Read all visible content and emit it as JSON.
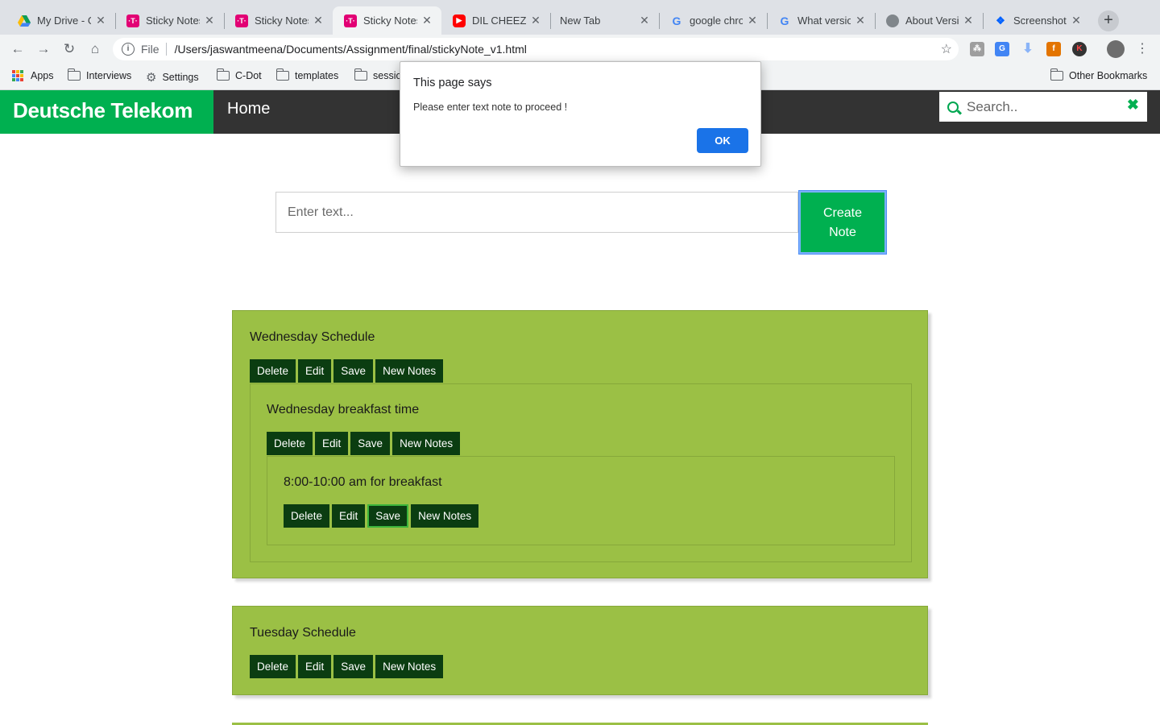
{
  "browser": {
    "tabs": [
      {
        "label": "My Drive - G",
        "icon": "google-drive-icon",
        "color": "#f4b400"
      },
      {
        "label": "Sticky Notes",
        "icon": "telekom-icon",
        "color": "#e20074"
      },
      {
        "label": "Sticky Notes",
        "icon": "telekom-icon",
        "color": "#e20074"
      },
      {
        "label": "Sticky Notes",
        "icon": "telekom-icon",
        "color": "#e20074",
        "active": true
      },
      {
        "label": "DIL CHEEZ T",
        "icon": "youtube-icon",
        "color": "#ff0000"
      },
      {
        "label": "New Tab",
        "icon": "",
        "color": ""
      },
      {
        "label": "google chro",
        "icon": "google-icon",
        "color": "#4285f4"
      },
      {
        "label": "What versio",
        "icon": "google-icon",
        "color": "#4285f4"
      },
      {
        "label": "About Versi",
        "icon": "globe-icon",
        "color": "#5f6368"
      },
      {
        "label": "Screenshot",
        "icon": "dropbox-icon",
        "color": "#0061ff"
      }
    ],
    "url_scheme": "File",
    "url": "/Users/jaswantmeena/Documents/Assignment/final/stickyNote_v1.html",
    "bookmarks": [
      "Apps",
      "Interviews",
      "Settings",
      "C-Dot",
      "templates",
      "sessio"
    ],
    "other_bookmarks": "Other Bookmarks"
  },
  "app": {
    "brand": "Deutsche Telekom",
    "nav_home": "Home",
    "search_placeholder": "Search..",
    "search_clear": "✖",
    "input_placeholder": "Enter text...",
    "create_label": "Create Note",
    "accent": "#00b050",
    "note_color": "#9bc045",
    "button_color": "#0b3d11"
  },
  "buttons": {
    "delete": "Delete",
    "edit": "Edit",
    "save": "Save",
    "new_notes": "New Notes"
  },
  "notes": [
    {
      "text": "Wednesday Schedule",
      "children": [
        {
          "text": "Wednesday breakfast time",
          "children": [
            {
              "text": "8:00-10:00 am for breakfast"
            }
          ]
        }
      ]
    },
    {
      "text": "Tuesday Schedule"
    }
  ],
  "dialog": {
    "title": "This page says",
    "message": "Please enter text note to proceed !",
    "ok_label": "OK"
  }
}
